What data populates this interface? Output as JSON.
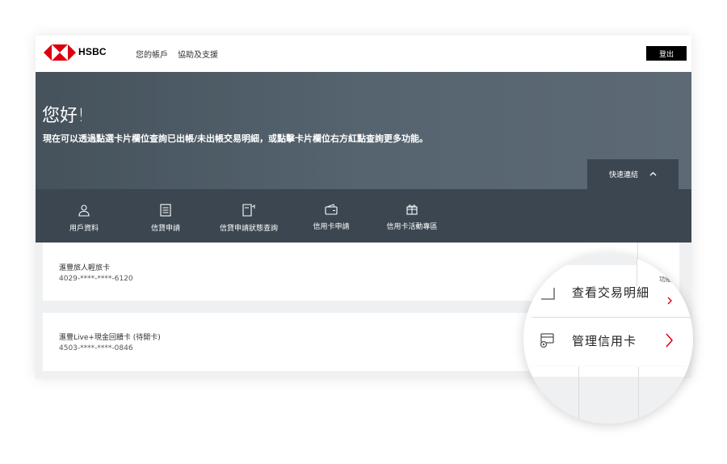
{
  "header": {
    "brand": "HSBC",
    "nav": {
      "accounts": "您的帳戶",
      "help": "協助及支援"
    },
    "logout": "登出"
  },
  "hero": {
    "greeting": "您好!",
    "subtitle": "現在可以透過點選卡片欄位查詢已出帳/未出帳交易明細，或點擊卡片欄位右方紅點查詢更多功能。",
    "quick_links": "快速連結"
  },
  "quick_bar": {
    "items": [
      {
        "label": "用戶資料",
        "icon": "user-icon"
      },
      {
        "label": "信貸申請",
        "icon": "document-icon"
      },
      {
        "label": "信貸申請狀態查詢",
        "icon": "document-status-icon"
      },
      {
        "label": "信用卡申請",
        "icon": "wallet-card-icon"
      },
      {
        "label": "信用卡活動專區",
        "icon": "gift-icon"
      }
    ]
  },
  "cards": [
    {
      "name": "滙豐旅人輕旅卡",
      "number": "4029-****-****-6120"
    },
    {
      "name": "滙豐Live+現金回饋卡 (待開卡)",
      "number": "4503-****-****-0846"
    }
  ],
  "magnifier": {
    "more_label": "功能",
    "items": [
      {
        "label": "查看交易明細",
        "icon": "transactions-icon"
      },
      {
        "label": "管理信用卡",
        "icon": "manage-card-icon"
      }
    ]
  },
  "colors": {
    "brand_red": "#db0011",
    "hero_bg": "#56646f",
    "quick_bar_bg": "#3b4650",
    "logout_bg": "#000000"
  }
}
